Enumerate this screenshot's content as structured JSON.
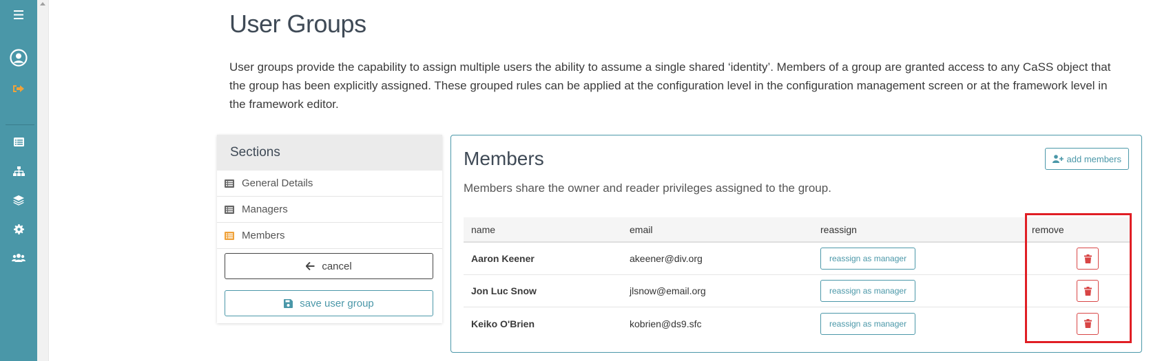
{
  "sidebar": {
    "icons": [
      "menu-icon",
      "user-circle-icon",
      "sign-out-icon",
      "list-icon",
      "sitemap-icon",
      "layers-icon",
      "gear-icon",
      "users-icon"
    ],
    "accent": "#4a97a8",
    "signout_color": "#f0a23a"
  },
  "page": {
    "title": "User Groups",
    "intro": "User groups provide the capability to assign multiple users the ability to assume a single shared ‘identity’. Members of a group are granted access to any CaSS object that the group has been explicitly assigned. These grouped rules can be applied at the configuration level in the configuration management screen or at the framework level in the framework editor."
  },
  "sections": {
    "title": "Sections",
    "items": [
      {
        "label": "General Details",
        "active": false
      },
      {
        "label": "Managers",
        "active": false
      },
      {
        "label": "Members",
        "active": true
      }
    ],
    "cancel_label": "cancel",
    "save_label": "save user group"
  },
  "members": {
    "title": "Members",
    "description": "Members share the owner and reader privileges assigned to the group.",
    "add_label": "add members",
    "columns": [
      "name",
      "email",
      "reassign",
      "remove"
    ],
    "rows": [
      {
        "name": "Aaron Keener",
        "email": "akeener@div.org",
        "reassign_label": "reassign as manager"
      },
      {
        "name": "Jon Luc Snow",
        "email": "jlsnow@email.org",
        "reassign_label": "reassign as manager"
      },
      {
        "name": "Keiko O'Brien",
        "email": "kobrien@ds9.sfc",
        "reassign_label": "reassign as manager"
      }
    ]
  },
  "colors": {
    "delete": "#d84545",
    "highlight": "#e01e24"
  }
}
